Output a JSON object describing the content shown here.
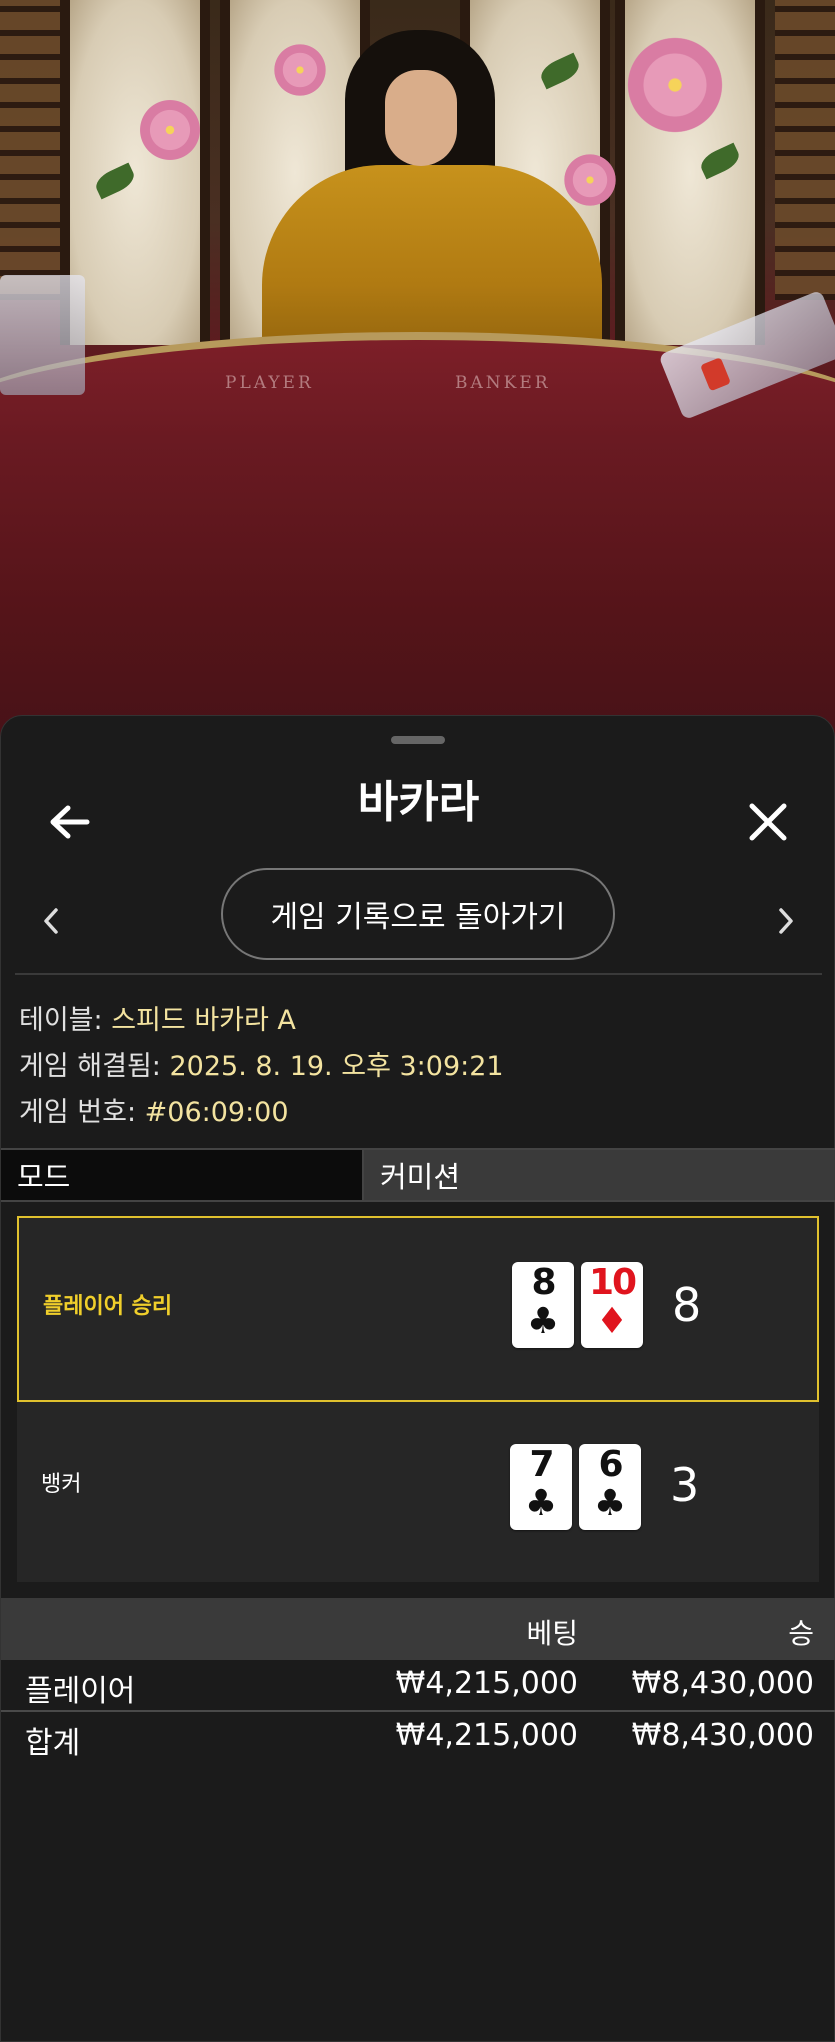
{
  "video": {
    "table_labels": [
      "PLAYER",
      "BANKER"
    ]
  },
  "header": {
    "title": "바카라",
    "back_icon": "arrow-left-icon",
    "close_icon": "close-icon"
  },
  "nav": {
    "back_to_history_label": "게임 기록으로 돌아가기",
    "prev_icon": "chevron-left-icon",
    "next_icon": "chevron-right-icon"
  },
  "info": {
    "table_label": "테이블:",
    "table_value": "스피드 바카라 A",
    "resolved_label": "게임 해결됨:",
    "resolved_value": "2025. 8. 19. 오후 3:09:21",
    "game_no_label": "게임 번호:",
    "game_no_value": "#06:09:00"
  },
  "tabs": {
    "mode": "모드",
    "commission": "커미션"
  },
  "results": {
    "player": {
      "label": "플레이어 승리",
      "cards": [
        {
          "rank": "8",
          "suit": "♣",
          "color": "#111111"
        },
        {
          "rank": "10",
          "suit": "♦",
          "color": "#e0141e"
        }
      ],
      "score": "8"
    },
    "banker": {
      "label": "뱅커",
      "cards": [
        {
          "rank": "7",
          "suit": "♣",
          "color": "#111111"
        },
        {
          "rank": "6",
          "suit": "♣",
          "color": "#111111"
        }
      ],
      "score": "3"
    },
    "winner_highlight_color": "#e0c12e"
  },
  "bets": {
    "header": {
      "bet": "베팅",
      "win": "승"
    },
    "rows": [
      {
        "label": "플레이어",
        "bet": "₩4,215,000",
        "win": "₩8,430,000"
      }
    ],
    "total": {
      "label": "합계",
      "bet": "₩4,215,000",
      "win": "₩8,430,000"
    }
  }
}
